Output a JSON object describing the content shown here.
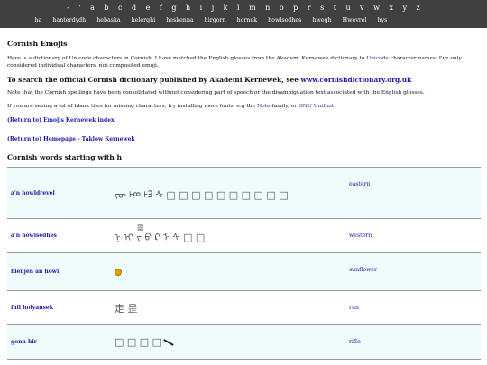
{
  "nav": {
    "letters": [
      "-",
      "'",
      "a",
      "b",
      "c",
      "d",
      "e",
      "f",
      "g",
      "h",
      "i",
      "j",
      "k",
      "l",
      "m",
      "n",
      "o",
      "p",
      "r",
      "s",
      "t",
      "u",
      "v",
      "w",
      "x",
      "y",
      "z"
    ],
    "words": [
      "ha",
      "hanterdydh",
      "hebaska",
      "helerghi",
      "heskenna",
      "hirgorn",
      "hornek",
      "howlsedhes",
      "hwegh",
      "Hwevrel",
      "hys"
    ]
  },
  "title": "Cornish Emojis",
  "intro": {
    "text1": "Here is a dictionary of Unicode characters in Cornish. I have matched the English glosses from the Akademi Kernewek dictionary to",
    "unicode_link": "Unicode",
    "text2": "character names. I've only considered individual characters, not composited emoji."
  },
  "search": {
    "text": "To search the official Cornish dictionary published by Akademi Kernewek, see",
    "link": "www.cornishdictionary.org.uk"
  },
  "note": "Note that the Cornish spellings have been consolidated without considering part of speech or the disambiguation text associated with the English glosses.",
  "fonts": {
    "text1": "If you are seeing a lot of blank tiles for missing characters, try installing more fonts, e.g the",
    "noto": "Noto",
    "text2": "family, or",
    "gnu": "GNU Unifont",
    "text3": "."
  },
  "links": {
    "index": "(Return to) Emojis Kernewek index",
    "homepage": "(Return to) Homepage - Taklow Kernewek"
  },
  "section_heading": "Cornish words starting with h",
  "rows": [
    {
      "word": "a'n howldrevel",
      "emoji": "ᡕᠦ ᡰᢁ ᡰᢃ ᠰ □ □ □ □ □ □ □ □ □ □",
      "gloss": "eastern"
    },
    {
      "word": "a'n howlsedhes",
      "emoji": "ᠨ ᡳ ᠵᢆ ᠪ ᠺ ᠮ ᠰ □ □",
      "gloss": "western"
    },
    {
      "word": "blenjen an howl",
      "emoji": "",
      "gloss": "sunflower"
    },
    {
      "word": "fall holyansek",
      "emoji": "走 昰",
      "gloss": "run"
    },
    {
      "word": "gonn hir",
      "emoji": "□ □ □ □",
      "gloss": "rifle"
    }
  ],
  "colors": {
    "nav_bg": "#404040",
    "link": "#1a1aa6",
    "row_alt_bg": "#f0fbfb"
  }
}
